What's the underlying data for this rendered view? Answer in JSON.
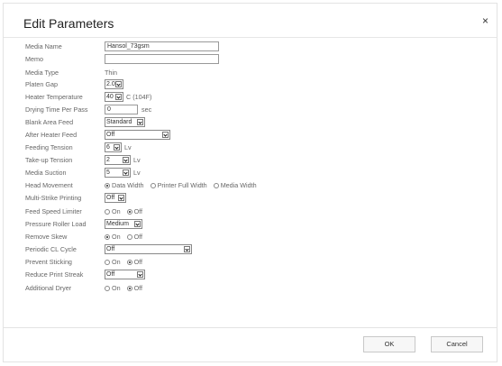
{
  "dialog": {
    "title": "Edit Parameters",
    "close_symbol": "×",
    "ok_label": "OK",
    "cancel_label": "Cancel"
  },
  "fields": {
    "media_name": {
      "label": "Media Name",
      "value": "Hansol_73gsm"
    },
    "memo": {
      "label": "Memo",
      "value": ""
    },
    "media_type": {
      "label": "Media Type",
      "value": "Thin"
    },
    "platen_gap": {
      "label": "Platen Gap",
      "value": "2.0"
    },
    "heater_temperature": {
      "label": "Heater Temperature",
      "value": "40",
      "suffix": "C (104F)"
    },
    "drying_time": {
      "label": "Drying Time Per Pass",
      "value": "0",
      "suffix": "sec"
    },
    "blank_area_feed": {
      "label": "Blank Area Feed",
      "value": "Standard"
    },
    "after_heater_feed": {
      "label": "After Heater Feed",
      "value": "Off"
    },
    "feeding_tension": {
      "label": "Feeding Tension",
      "value": "6",
      "suffix": "Lv"
    },
    "takeup_tension": {
      "label": "Take-up Tension",
      "value": "2",
      "suffix": "Lv"
    },
    "media_suction": {
      "label": "Media Suction",
      "value": "5",
      "suffix": "Lv"
    },
    "head_movement": {
      "label": "Head Movement",
      "options": [
        "Data Width",
        "Printer Full Width",
        "Media Width"
      ],
      "selected": "Data Width"
    },
    "multi_strike": {
      "label": "Multi-Strike Printing",
      "value": "Off"
    },
    "feed_speed_limiter": {
      "label": "Feed Speed Limiter",
      "options": [
        "On",
        "Off"
      ],
      "selected": "Off"
    },
    "pressure_roller_load": {
      "label": "Pressure Roller Load",
      "value": "Medium"
    },
    "remove_skew": {
      "label": "Remove Skew",
      "options": [
        "On",
        "Off"
      ],
      "selected": "On"
    },
    "periodic_cl_cycle": {
      "label": "Periodic CL Cycle",
      "value": "Off"
    },
    "prevent_sticking": {
      "label": "Prevent Sticking",
      "options": [
        "On",
        "Off"
      ],
      "selected": "Off"
    },
    "reduce_print_streak": {
      "label": "Reduce Print Streak",
      "value": "Off"
    },
    "additional_dryer": {
      "label": "Additional Dryer",
      "options": [
        "On",
        "Off"
      ],
      "selected": "Off"
    }
  }
}
